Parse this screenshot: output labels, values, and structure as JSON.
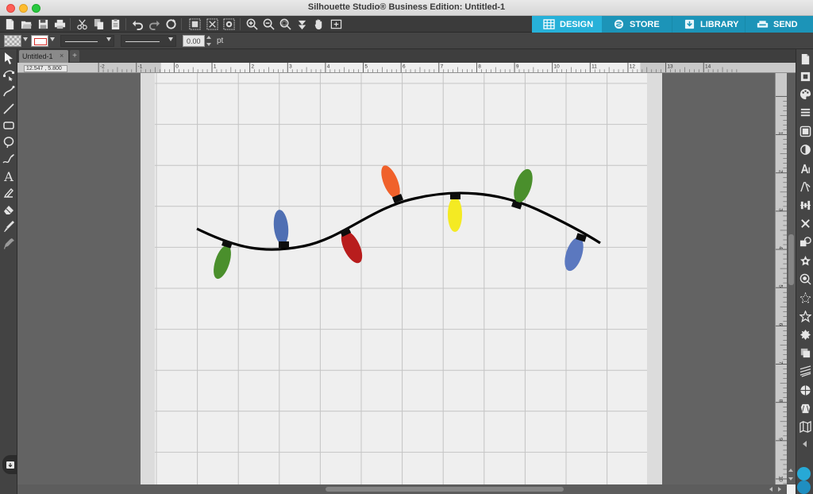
{
  "window": {
    "title": "Silhouette Studio® Business Edition: Untitled-1"
  },
  "toolbar": {
    "icons": [
      "new-page-icon",
      "open-icon",
      "save-icon",
      "print-icon",
      "cut-icon",
      "copy-icon",
      "paste-icon",
      "undo-icon",
      "redo-icon",
      "redraw-icon",
      "group-icon",
      "ungroup-icon",
      "compound-path-icon",
      "zoom-in-icon",
      "zoom-out-icon",
      "zoom-selection-icon",
      "move-down-icon",
      "pan-icon",
      "fit-page-icon"
    ]
  },
  "nav_tabs": [
    {
      "label": "DESIGN",
      "icon": "grid-icon",
      "active": true
    },
    {
      "label": "STORE",
      "icon": "store-icon",
      "active": false
    },
    {
      "label": "LIBRARY",
      "icon": "library-icon",
      "active": false
    },
    {
      "label": "SEND",
      "icon": "send-icon",
      "active": false
    }
  ],
  "properties": {
    "line_width_value": "0.00",
    "line_width_unit": "pt"
  },
  "document": {
    "tab_label": "Untitled-1",
    "tab_close": "×",
    "add_tab": "+",
    "coordinates": "12.547 , 5.800"
  },
  "ruler": {
    "horizontal_labels": [
      "-2",
      "-1",
      "0",
      "1",
      "2",
      "3",
      "4",
      "5",
      "6",
      "7",
      "8",
      "9",
      "10",
      "11",
      "12",
      "13",
      "14"
    ],
    "vertical_labels": [
      "1",
      "2",
      "3",
      "4",
      "5",
      "6",
      "7",
      "8",
      "9",
      "10"
    ]
  },
  "colors": {
    "accent": "#27b1d9",
    "accent_dark": "#1c94b8",
    "canvas_bg": "#eeeeee",
    "grid_line": "#c4c4c4",
    "string": "#000000"
  },
  "design": {
    "description_items": [
      "light-string",
      "bulbs"
    ],
    "bulbs": [
      {
        "color": "#4a8f2c"
      },
      {
        "color": "#4f6fb3"
      },
      {
        "color": "#b81d1d"
      },
      {
        "color": "#f0612b"
      },
      {
        "color": "#f4ea23"
      },
      {
        "color": "#4a8f2c"
      },
      {
        "color": "#5b78bf"
      }
    ]
  }
}
